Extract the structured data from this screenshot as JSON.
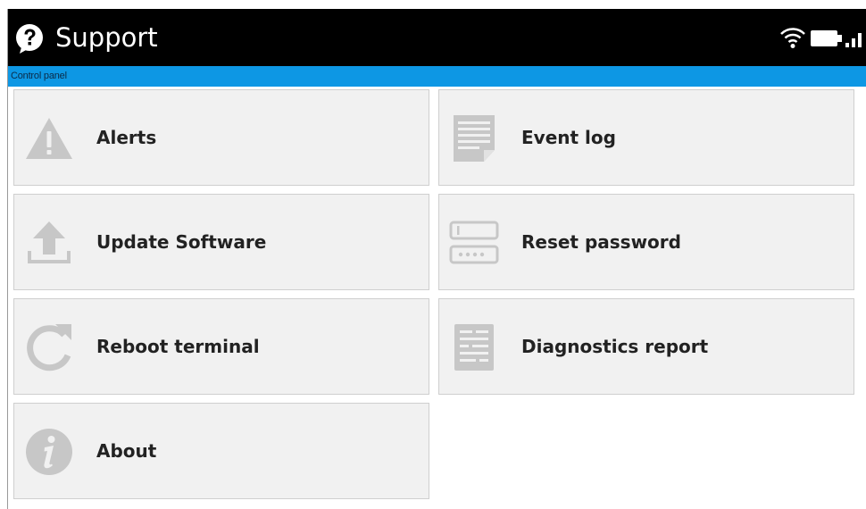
{
  "header": {
    "title": "Support",
    "help_icon": "question-mark-icon",
    "status_icons": [
      "wifi-icon",
      "battery-icon",
      "signal-strength-icon"
    ]
  },
  "breadcrumb": {
    "label": "Control panel"
  },
  "tiles": [
    {
      "label": "Alerts",
      "icon": "warning-icon"
    },
    {
      "label": "Event log",
      "icon": "document-icon"
    },
    {
      "label": "Update Software",
      "icon": "upload-icon"
    },
    {
      "label": "Reset password",
      "icon": "password-field-icon"
    },
    {
      "label": "Reboot terminal",
      "icon": "reboot-icon"
    },
    {
      "label": "Diagnostics report",
      "icon": "report-icon"
    },
    {
      "label": "About",
      "icon": "info-icon"
    }
  ],
  "colors": {
    "titlebar_bg": "#000000",
    "accent_bar": "#0d97e4",
    "tile_bg": "#f1f1f1",
    "tile_border": "#cfcfcf",
    "icon_gray": "#c7c7c7",
    "label_text": "#222222"
  }
}
